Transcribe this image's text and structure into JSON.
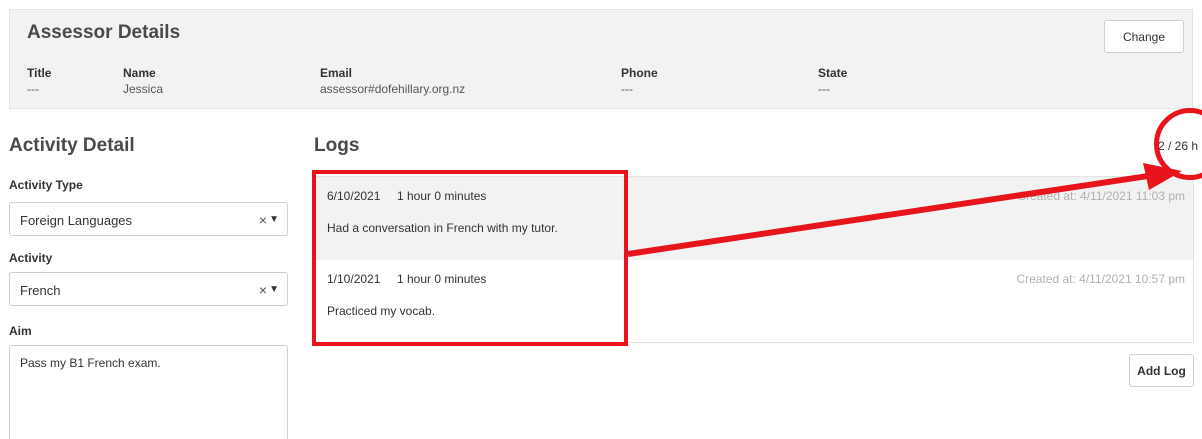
{
  "assessor": {
    "title": "Assessor Details",
    "change_label": "Change",
    "fields": {
      "title_label": "Title",
      "title_value": "---",
      "name_label": "Name",
      "name_value": "Jessica",
      "email_label": "Email",
      "email_value": "assessor#dofehillary.org.nz",
      "phone_label": "Phone",
      "phone_value": "---",
      "state_label": "State",
      "state_value": "---"
    }
  },
  "activity": {
    "title": "Activity Detail",
    "type_label": "Activity Type",
    "type_value": "Foreign Languages",
    "activity_label": "Activity",
    "activity_value": "French",
    "aim_label": "Aim",
    "aim_value": "Pass my B1 French exam.",
    "clear_glyph": "×",
    "arrow_glyph": "▼"
  },
  "logs": {
    "title": "Logs",
    "hours": "2 / 26 h",
    "entries": [
      {
        "date": "6/10/2021",
        "duration": "1 hour  0 minutes",
        "created": "Created at: 4/11/2021 11:03 pm",
        "description": "Had a conversation in French with my tutor."
      },
      {
        "date": "1/10/2021",
        "duration": "1 hour  0 minutes",
        "created": "Created at: 4/11/2021 10:57 pm",
        "description": "Practiced my vocab."
      }
    ],
    "add_label": "Add Log"
  },
  "annotation": {
    "color": "#e8141c"
  }
}
